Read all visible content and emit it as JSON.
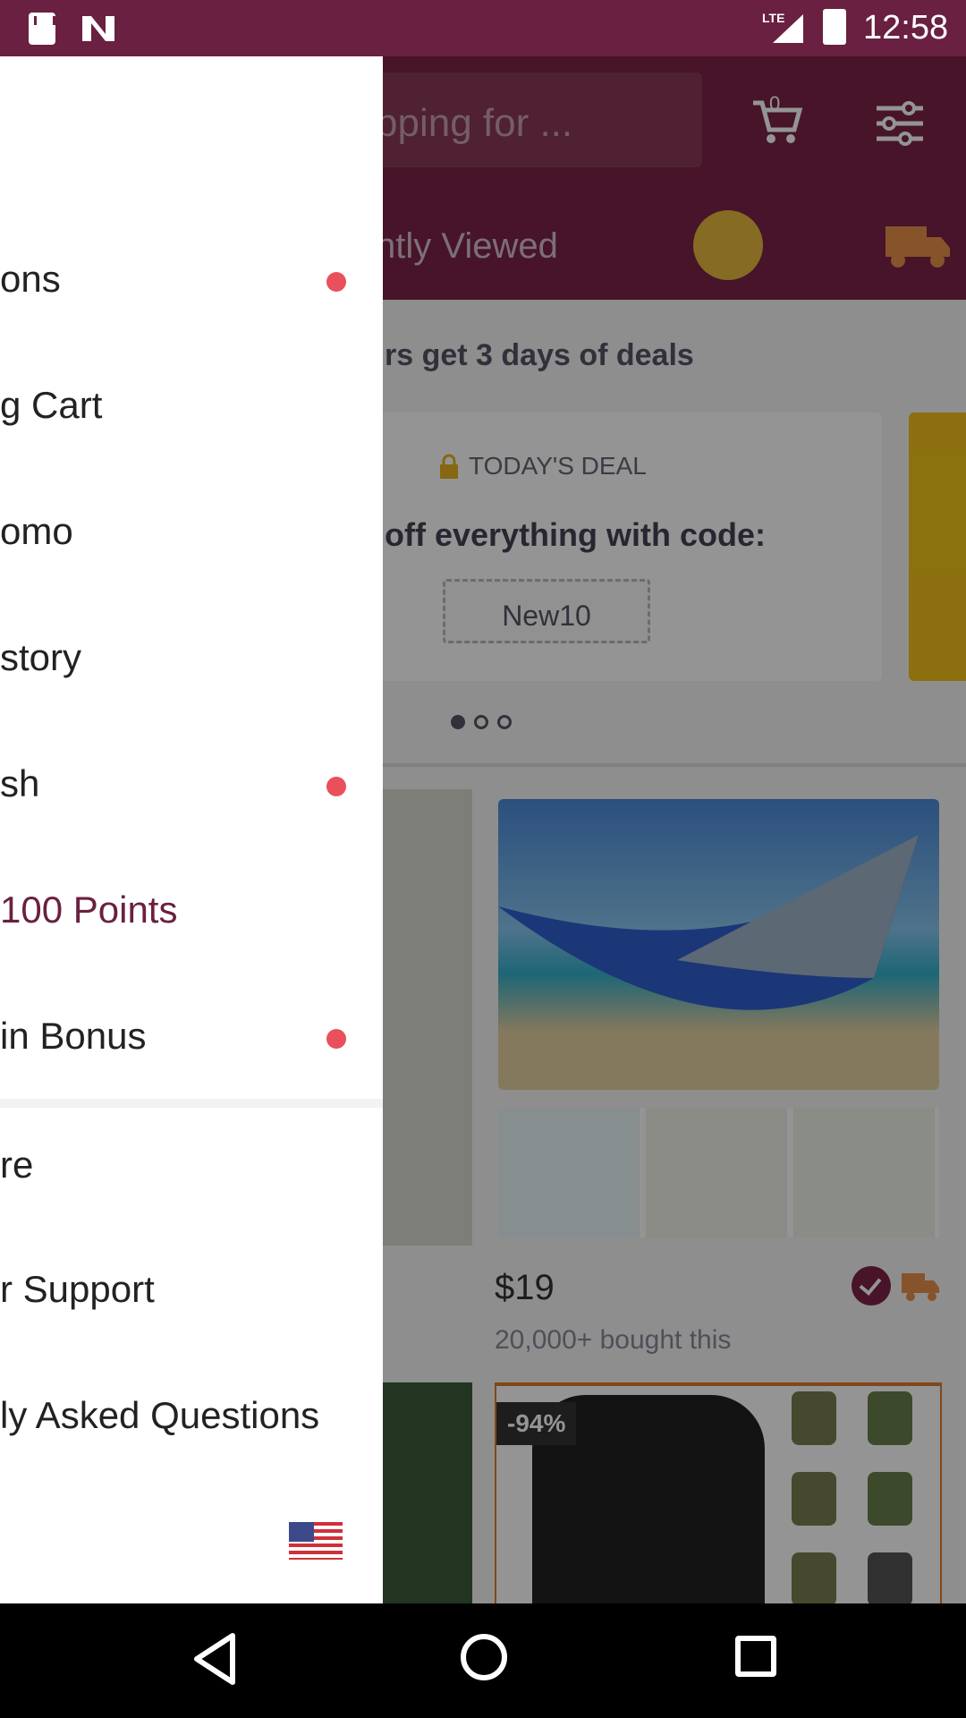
{
  "status_bar": {
    "network": "LTE",
    "time": "12:58"
  },
  "header": {
    "search_placeholder": "pping for ...",
    "cart_count": "0",
    "recent_tab": "ntly Viewed"
  },
  "content": {
    "deals_line": "rs get 3 days of deals",
    "deal_title": "TODAY'S DEAL",
    "deal_desc": "off everything with code:",
    "deal_code": "New10",
    "product_price": "$19",
    "product_bought": "20,000+ bought this",
    "product_discount": "-94%"
  },
  "drawer": {
    "items": [
      {
        "label": "ons",
        "dot": true
      },
      {
        "label": "g Cart",
        "dot": false
      },
      {
        "label": "omo",
        "dot": false
      },
      {
        "label": "story",
        "dot": false
      },
      {
        "label": "sh",
        "dot": true
      },
      {
        "label": " 100 Points",
        "dot": false
      },
      {
        "label": "in Bonus",
        "dot": true
      },
      {
        "label": "re",
        "dot": false
      },
      {
        "label": "r Support",
        "dot": false
      },
      {
        "label": "ly Asked Questions",
        "dot": false
      }
    ],
    "flag": "us-flag-icon"
  },
  "colors": {
    "brand": "#7a2448",
    "accent_dot": "#e9505b",
    "points_text": "#6a2040"
  }
}
